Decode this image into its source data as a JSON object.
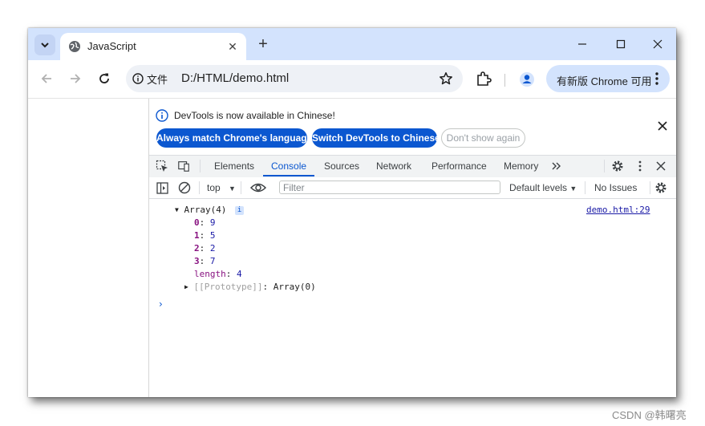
{
  "browser": {
    "tab": {
      "title": "JavaScript"
    },
    "address": {
      "chip_label": "文件",
      "url": "D:/HTML/demo.html"
    },
    "update_button": {
      "label": "有新版 Chrome 可用"
    }
  },
  "devtools": {
    "infobar": {
      "message": "DevTools is now available in Chinese!",
      "buttons": [
        "Always match Chrome's language",
        "Switch DevTools to Chinese",
        "Don't show again"
      ]
    },
    "panel_tabs": [
      "Elements",
      "Console",
      "Sources",
      "Network",
      "Performance",
      "Memory"
    ],
    "active_tab": "Console",
    "console_toolbar": {
      "context": "top",
      "filter_placeholder": "Filter",
      "levels": "Default levels",
      "issues": "No Issues"
    },
    "console": {
      "array_label": "Array(4)",
      "info_badge": "i",
      "source_link": "demo.html:29",
      "entries": [
        {
          "key": "0",
          "value": "9"
        },
        {
          "key": "1",
          "value": "5"
        },
        {
          "key": "2",
          "value": "2"
        },
        {
          "key": "3",
          "value": "7"
        }
      ],
      "length_key": "length",
      "length_value": "4",
      "prototype_key": "[[Prototype]]",
      "prototype_value": "Array(0)",
      "prompt": "›"
    }
  },
  "watermark": "CSDN @韩曙亮",
  "colors": {
    "accent": "#0b57d0",
    "tabstrip": "#d3e3fd",
    "key": "#881280",
    "number": "#1a1aa6"
  }
}
